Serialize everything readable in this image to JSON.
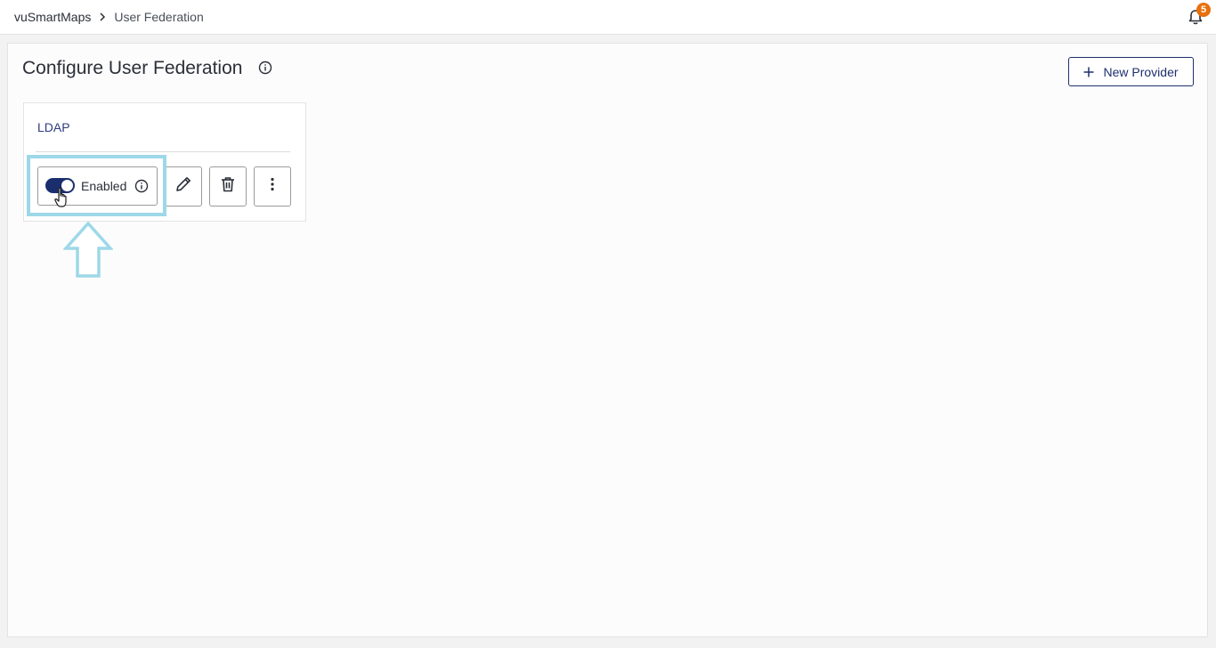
{
  "breadcrumb": {
    "root": "vuSmartMaps",
    "current": "User Federation"
  },
  "notifications": {
    "icon": "bell-icon",
    "count": "5",
    "badge_color": "#e8700a"
  },
  "page": {
    "title": "Configure User Federation",
    "new_provider_label": "New Provider"
  },
  "providers": [
    {
      "name": "LDAP",
      "enabled": true,
      "toggle_label": "Enabled",
      "actions": [
        "edit-icon",
        "trash-icon",
        "more-vertical-icon"
      ]
    }
  ],
  "colors": {
    "accent": "#1a2e6e",
    "link": "#2e3a82",
    "highlight": "#9dd8e8"
  }
}
